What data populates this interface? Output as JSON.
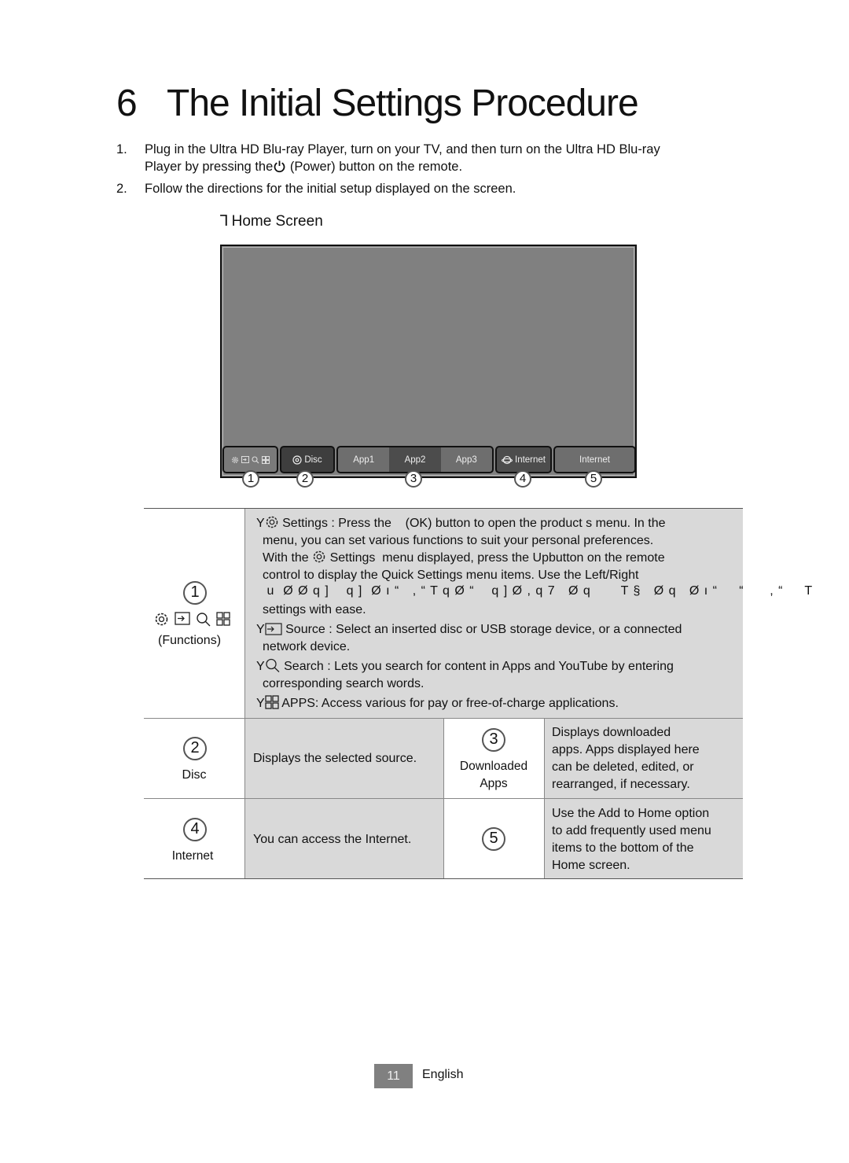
{
  "header": {
    "chapter_number": "6",
    "title": "The Initial Settings Procedure"
  },
  "steps": [
    {
      "num": "1.",
      "line1": "Plug in the Ultra HD Blu-ray Player, turn on your TV, and then turn on the Ultra HD Blu-ray",
      "line2_before": "Player by pressing the",
      "line2_icon": "power-icon",
      "line2_after": " (Power) button on the remote."
    },
    {
      "num": "2.",
      "line1": "Follow the directions for the initial setup displayed on the screen."
    }
  ],
  "section": {
    "glyph": "Ꞁ",
    "label": "Home Screen"
  },
  "home_screen": {
    "background": "#808080",
    "tiles": {
      "functions_icons": [
        "settings-icon",
        "source-icon",
        "search-icon",
        "apps-icon"
      ],
      "disc_label": "Disc",
      "apps": [
        "App1",
        "App2",
        "App3"
      ],
      "internet_label": "Internet",
      "add_home_label": "Internet"
    },
    "callouts": [
      "1",
      "2",
      "3",
      "4",
      "5"
    ]
  },
  "table": {
    "row1": {
      "badge": "1",
      "icons": [
        "settings-icon",
        "source-icon",
        "search-icon",
        "apps-icon"
      ],
      "label": "(Functions)",
      "settings": {
        "bullet": "Y",
        "l1a": "Settings : Press the    (OK) button to open the product s menu. In the",
        "l2": "menu, you can set various functions to suit your personal preferences.",
        "l3a": "With the",
        "l3b": "Settings  menu displayed, press the Upbutton on the remote",
        "l4": "control to display the Quick Settings  menu items. Use the Left/Right",
        "l5": " u  Ø Ø q ]    q ]  Ø ı “   , “ T q Ø “    q ] Ø , q 7   Ø q       T §   Ø q   Ø ı “     “      , “     T",
        "l6": "settings with ease."
      },
      "source": {
        "bullet": "Y",
        "l1": "Source : Select an inserted disc or USB storage device, or a connected",
        "l2": "network device."
      },
      "search": {
        "bullet": "Y",
        "l1": "Search : Lets you search for content in Apps and YouTube by entering",
        "l2": "corresponding search words."
      },
      "apps": {
        "bullet": "Y",
        "l1": "APPS: Access various for pay or free-of-charge applications."
      }
    },
    "row2": {
      "left": {
        "badge": "2",
        "label": "Disc",
        "desc": "Displays the selected source."
      },
      "right": {
        "badge": "3",
        "label1": "Downloaded",
        "label2": "Apps",
        "desc": [
          "Displays downloaded",
          "apps. Apps displayed here",
          "can be deleted, edited, or",
          "rearranged, if necessary."
        ]
      }
    },
    "row3": {
      "left": {
        "badge": "4",
        "label": "Internet",
        "desc": "You can access the Internet."
      },
      "right": {
        "badge": "5",
        "desc": [
          "Use the Add to Home option",
          "to add frequently used menu",
          "items to the bottom of the",
          "Home screen."
        ]
      }
    }
  },
  "footer": {
    "page": "11",
    "language": "English"
  }
}
